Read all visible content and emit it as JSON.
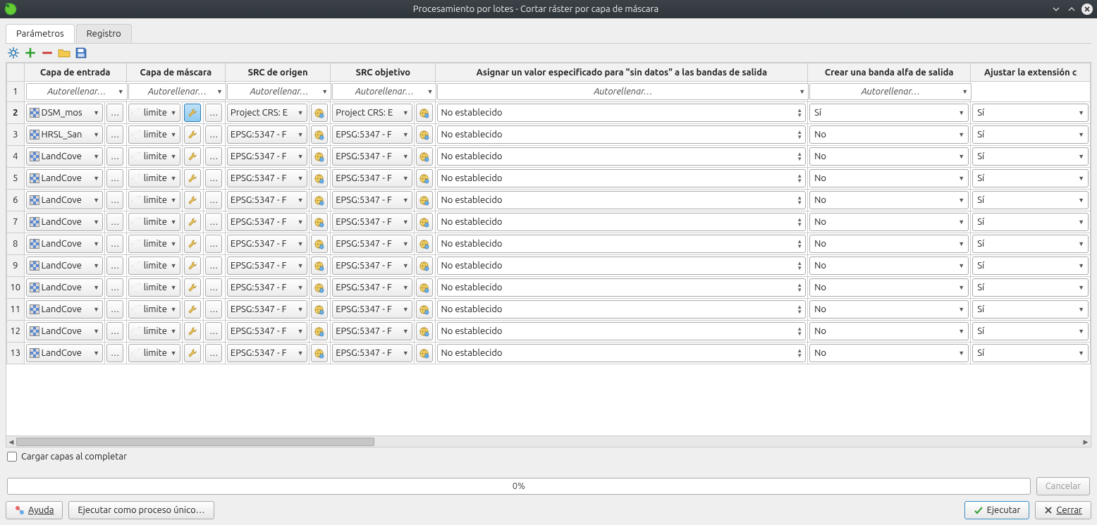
{
  "window": {
    "title": "Procesamiento por lotes - Cortar ráster por capa de máscara"
  },
  "tabs": {
    "parameters": "Parámetros",
    "log": "Registro"
  },
  "autofill": "Autorellenar…",
  "columns": {
    "row": "1",
    "input": "Capa de entrada",
    "mask": "Capa de máscara",
    "src_crs": "SRC de origen",
    "tgt_crs": "SRC objetivo",
    "nodata": "Asignar un valor especificado para \"sin datos\" a las bandas de salida",
    "alpha": "Crear una banda alfa de salida",
    "extent": "Ajustar la extensión c"
  },
  "mask_label": "limite",
  "crs_project": "Project CRS: E",
  "crs_epsg": "EPSG:5347 - F",
  "nodata_val": "No establecido",
  "yes": "Sí",
  "no": "No",
  "rows": [
    {
      "n": "2",
      "layer": "DSM_mos",
      "crs": "project",
      "alpha": "Sí",
      "sel": true
    },
    {
      "n": "3",
      "layer": "HRSL_San",
      "crs": "epsg",
      "alpha": "No",
      "sel": false
    },
    {
      "n": "4",
      "layer": "LandCove",
      "crs": "epsg",
      "alpha": "No",
      "sel": false
    },
    {
      "n": "5",
      "layer": "LandCove",
      "crs": "epsg",
      "alpha": "No",
      "sel": false
    },
    {
      "n": "6",
      "layer": "LandCove",
      "crs": "epsg",
      "alpha": "No",
      "sel": false
    },
    {
      "n": "7",
      "layer": "LandCove",
      "crs": "epsg",
      "alpha": "No",
      "sel": false
    },
    {
      "n": "8",
      "layer": "LandCove",
      "crs": "epsg",
      "alpha": "No",
      "sel": false
    },
    {
      "n": "9",
      "layer": "LandCove",
      "crs": "epsg",
      "alpha": "No",
      "sel": false
    },
    {
      "n": "10",
      "layer": "LandCove",
      "crs": "epsg",
      "alpha": "No",
      "sel": false
    },
    {
      "n": "11",
      "layer": "LandCove",
      "crs": "epsg",
      "alpha": "No",
      "sel": false
    },
    {
      "n": "12",
      "layer": "LandCove",
      "crs": "epsg",
      "alpha": "No",
      "sel": false
    },
    {
      "n": "13",
      "layer": "LandCove",
      "crs": "epsg",
      "alpha": "No",
      "sel": false
    }
  ],
  "load_on_complete": "Cargar capas al completar",
  "progress": "0%",
  "buttons": {
    "cancel": "Cancelar",
    "help": "Ayuda",
    "run_single": "Ejecutar como proceso único…",
    "run": "Ejecutar",
    "close": "Cerrar"
  }
}
